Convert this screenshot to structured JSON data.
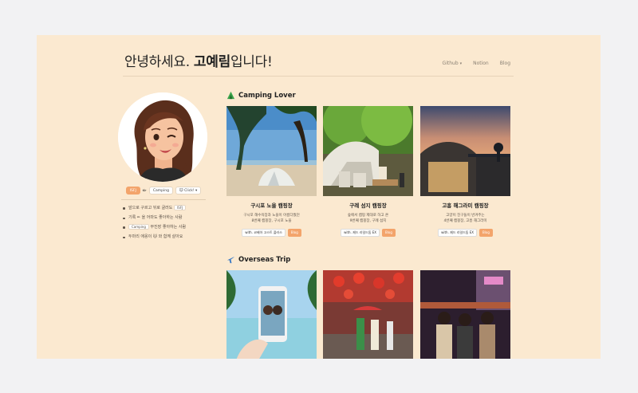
{
  "header": {
    "title_prefix": "안녕하세요. ",
    "title_name": "고예림",
    "title_suffix": "입니다!",
    "nav": {
      "github": "Github",
      "notion": "Notion",
      "blog": "Blog"
    }
  },
  "profile": {
    "badges": {
      "mbti": "ISFJ",
      "camping": "Camping",
      "click": "Click!"
    },
    "intro": [
      {
        "text_a": "앞으로 구르고 뒤로 굴러도",
        "tag": "ISFJ"
      },
      {
        "text_a": "기록",
        "text_b": "을 어마도 좋아하는 사람"
      },
      {
        "tag": "Camping",
        "text_b": "무진장 좋아하는 사람"
      },
      {
        "text_a": "두마리 애옹이",
        "text_b": "와 함께 살아요"
      }
    ]
  },
  "sections": {
    "camping": "Camping Lover",
    "overseas": "Overseas Trip"
  },
  "cards": [
    {
      "title": "구시포 노을 캠핑장",
      "line1": "구시포 해수욕장과 노을이 아름다웠던",
      "line2": "8번째 캠핑장, 구시포 노을",
      "chip": "with. 코베아 고스트 플러스",
      "blog": "Blog"
    },
    {
      "title": "구례 섬지 캠핑장",
      "line1": "숲에서 캠핑 제대로 하고 온",
      "line2": "9번째 캠핑장, 구례 섬지",
      "chip": "with. 제드 라일드돔 EX",
      "blog": "Blog"
    },
    {
      "title": "고흥 해그라미 캠핑장",
      "line1": "고양이 친구들이 반겨주는",
      "line2": "4번째 캠핑장, 고흥 해그라미",
      "chip": "with. 제드 라일드돔 EX",
      "blog": "Blog"
    }
  ],
  "colors": {
    "page_bg": "#fbe9d0",
    "outer_bg": "#f2f2f3",
    "accent": "#f3a46b"
  }
}
